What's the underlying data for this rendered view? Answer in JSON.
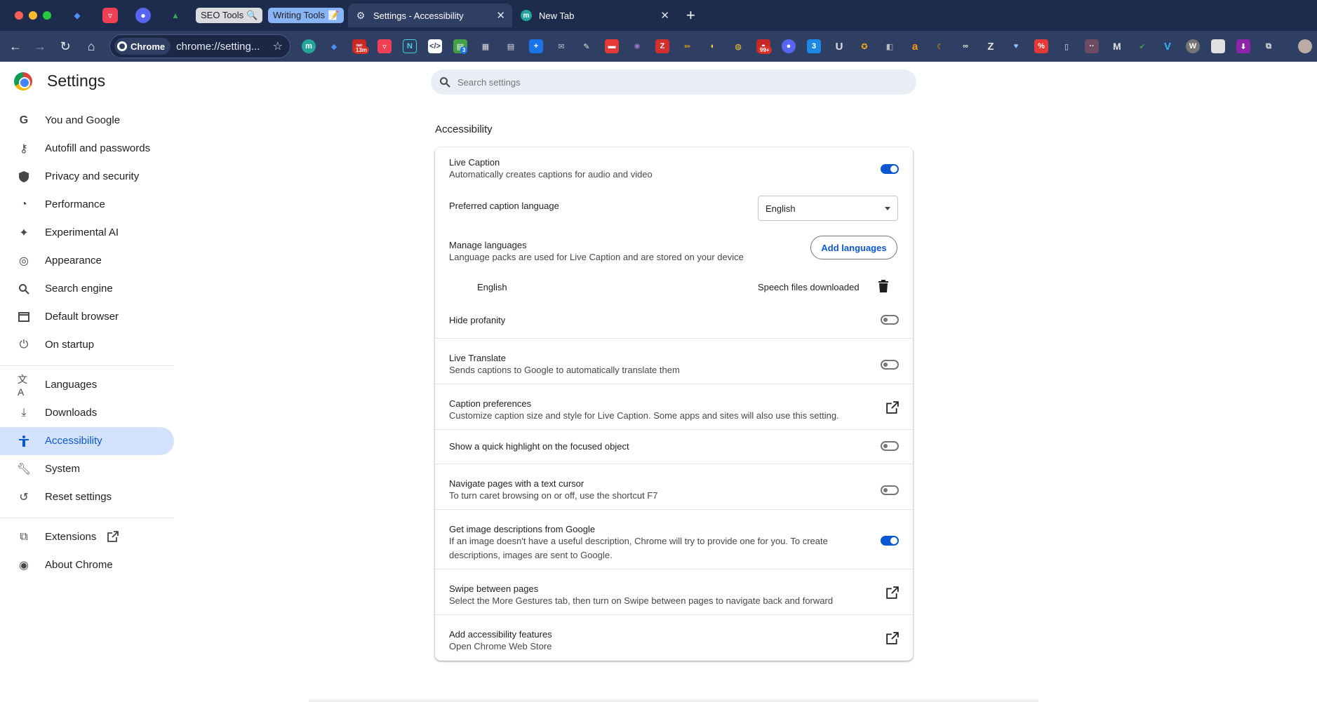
{
  "browser": {
    "tab_groups": [
      {
        "label": "SEO Tools",
        "emoji": "🔍"
      },
      {
        "label": "Writing Tools",
        "emoji": "📝"
      }
    ],
    "tabs": [
      {
        "title": "Settings - Accessibility",
        "active": true
      },
      {
        "title": "New Tab",
        "active": false
      }
    ],
    "omnibox": {
      "chip": "Chrome",
      "url": "chrome://setting..."
    },
    "extension_badges": [
      "13m",
      "3",
      "99+"
    ]
  },
  "settings": {
    "title": "Settings",
    "search_placeholder": "Search settings",
    "nav": [
      {
        "label": "You and Google",
        "icon": "google-g-icon"
      },
      {
        "label": "Autofill and passwords",
        "icon": "key-icon"
      },
      {
        "label": "Privacy and security",
        "icon": "shield-icon"
      },
      {
        "label": "Performance",
        "icon": "speedometer-icon"
      },
      {
        "label": "Experimental AI",
        "icon": "sparkle-icon"
      },
      {
        "label": "Appearance",
        "icon": "palette-icon"
      },
      {
        "label": "Search engine",
        "icon": "search-icon"
      },
      {
        "label": "Default browser",
        "icon": "browser-window-icon"
      },
      {
        "label": "On startup",
        "icon": "power-icon"
      },
      {
        "label": "Languages",
        "icon": "translate-icon"
      },
      {
        "label": "Downloads",
        "icon": "download-icon"
      },
      {
        "label": "Accessibility",
        "icon": "accessibility-icon",
        "active": true
      },
      {
        "label": "System",
        "icon": "wrench-icon"
      },
      {
        "label": "Reset settings",
        "icon": "reset-icon"
      },
      {
        "label": "Extensions",
        "icon": "puzzle-icon"
      },
      {
        "label": "About Chrome",
        "icon": "chrome-icon"
      }
    ]
  },
  "accessibility": {
    "section_title": "Accessibility",
    "live_caption": {
      "title": "Live Caption",
      "desc": "Automatically creates captions for audio and video",
      "on": true
    },
    "caption_language": {
      "title": "Preferred caption language",
      "value": "English"
    },
    "manage_languages": {
      "title": "Manage languages",
      "desc": "Language packs are used for Live Caption and are stored on your device",
      "button": "Add languages"
    },
    "language_item": {
      "name": "English",
      "status": "Speech files downloaded"
    },
    "hide_profanity": {
      "title": "Hide profanity",
      "on": false
    },
    "live_translate": {
      "title": "Live Translate",
      "desc": "Sends captions to Google to automatically translate them",
      "on": false
    },
    "caption_prefs": {
      "title": "Caption preferences",
      "desc": "Customize caption size and style for Live Caption. Some apps and sites will also use this setting."
    },
    "quick_highlight": {
      "title": "Show a quick highlight on the focused object",
      "on": false
    },
    "text_cursor": {
      "title": "Navigate pages with a text cursor",
      "desc": "To turn caret browsing on or off, use the shortcut F7",
      "on": false
    },
    "image_desc": {
      "title": "Get image descriptions from Google",
      "desc": "If an image doesn't have a useful description, Chrome will try to provide one for you. To create descriptions, images are sent to Google.",
      "on": true
    },
    "swipe": {
      "title": "Swipe between pages",
      "desc": "Select the More Gestures tab, then turn on Swipe between pages to navigate back and forward"
    },
    "add_features": {
      "title": "Add accessibility features",
      "desc": "Open Chrome Web Store"
    }
  },
  "colors": {
    "accent": "#0b57d0",
    "nav_active_bg": "#d3e3fd",
    "frame": "#1d2b4c",
    "toolbar": "#2f3e63"
  }
}
